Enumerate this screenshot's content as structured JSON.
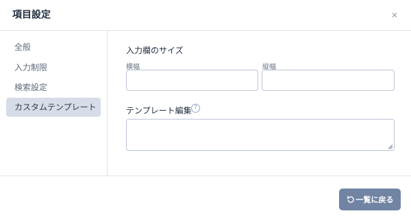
{
  "dialog": {
    "title": "項目設定",
    "close_glyph": "×"
  },
  "sidebar": {
    "items": [
      {
        "label": "全般",
        "active": false
      },
      {
        "label": "入力制限",
        "active": false
      },
      {
        "label": "検索設定",
        "active": false
      },
      {
        "label": "カスタムテンプレート",
        "active": true
      }
    ]
  },
  "main": {
    "input_size_title": "入力欄のサイズ",
    "width_label": "横幅",
    "width_value": "",
    "height_label": "縦幅",
    "height_value": "",
    "template_label": "テンプレート編集",
    "help_glyph": "?",
    "template_value": ""
  },
  "footer": {
    "back_button_label": "一覧に戻る",
    "back_icon": "undo-icon"
  },
  "colors": {
    "accent_button": "#7184a3",
    "active_nav_bg": "#d6dde8",
    "border": "#dfe3ee",
    "input_border": "#b9c3d4"
  }
}
